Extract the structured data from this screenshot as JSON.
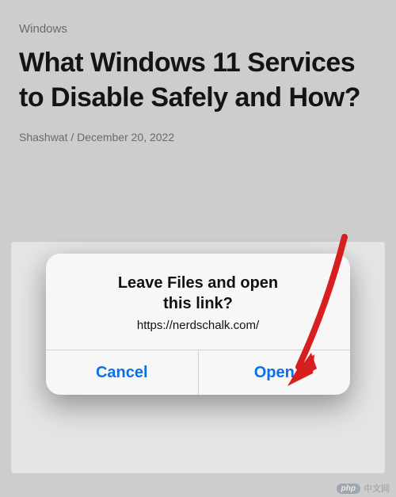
{
  "article": {
    "category": "Windows",
    "title": "What Windows 11 Services to Disable Safely and How?",
    "author": "Shashwat",
    "date": "December 20, 2022"
  },
  "dialog": {
    "title_line1": "Leave Files and open",
    "title_line2": "this link?",
    "url": "https://nerdschalk.com/",
    "cancel_label": "Cancel",
    "open_label": "Open"
  },
  "watermark": {
    "badge": "php",
    "text": "中文网"
  },
  "annotation": {
    "arrow": "red-arrow-pointing-to-open-button"
  }
}
